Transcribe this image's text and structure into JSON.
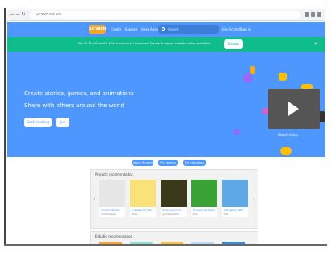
{
  "browser": {
    "url": "scratch.mit.edu"
  },
  "header": {
    "logo": "Scratch",
    "nav": [
      "Create",
      "Explore",
      "Ideas",
      "About"
    ],
    "search_placeholder": "Search",
    "join": "Join Scratch",
    "signin": "Sign in"
  },
  "banner": {
    "text": "May 15-31 is Scratch's 15th Anniversary! Learn more. Donate to support creative coding worldwide.",
    "donate": "Donate"
  },
  "hero": {
    "line1": "Create stories, games, and animations",
    "line2": "Share with others around the world",
    "start": "Start Creating",
    "join": "Join",
    "watch": "Watch Video"
  },
  "pills": [
    "About Scratch",
    "For Parents",
    "For Educators"
  ],
  "featured": {
    "heading": "Projects recomendados",
    "projects": [
      {
        "title": "Conflict Games",
        "author": "Scratchteam"
      },
      {
        "title": "A Wabbit Fer Ma...",
        "author": "Hitsu"
      },
      {
        "title": "Dixie Dream Cl...",
        "author": "grobbelers25"
      },
      {
        "title": "Scratch Cat Milam",
        "author": "Ella"
      },
      {
        "title": "TILT game (WIP)",
        "author": "Ella"
      }
    ]
  },
  "studios": {
    "heading": "Estudio recomendados"
  }
}
